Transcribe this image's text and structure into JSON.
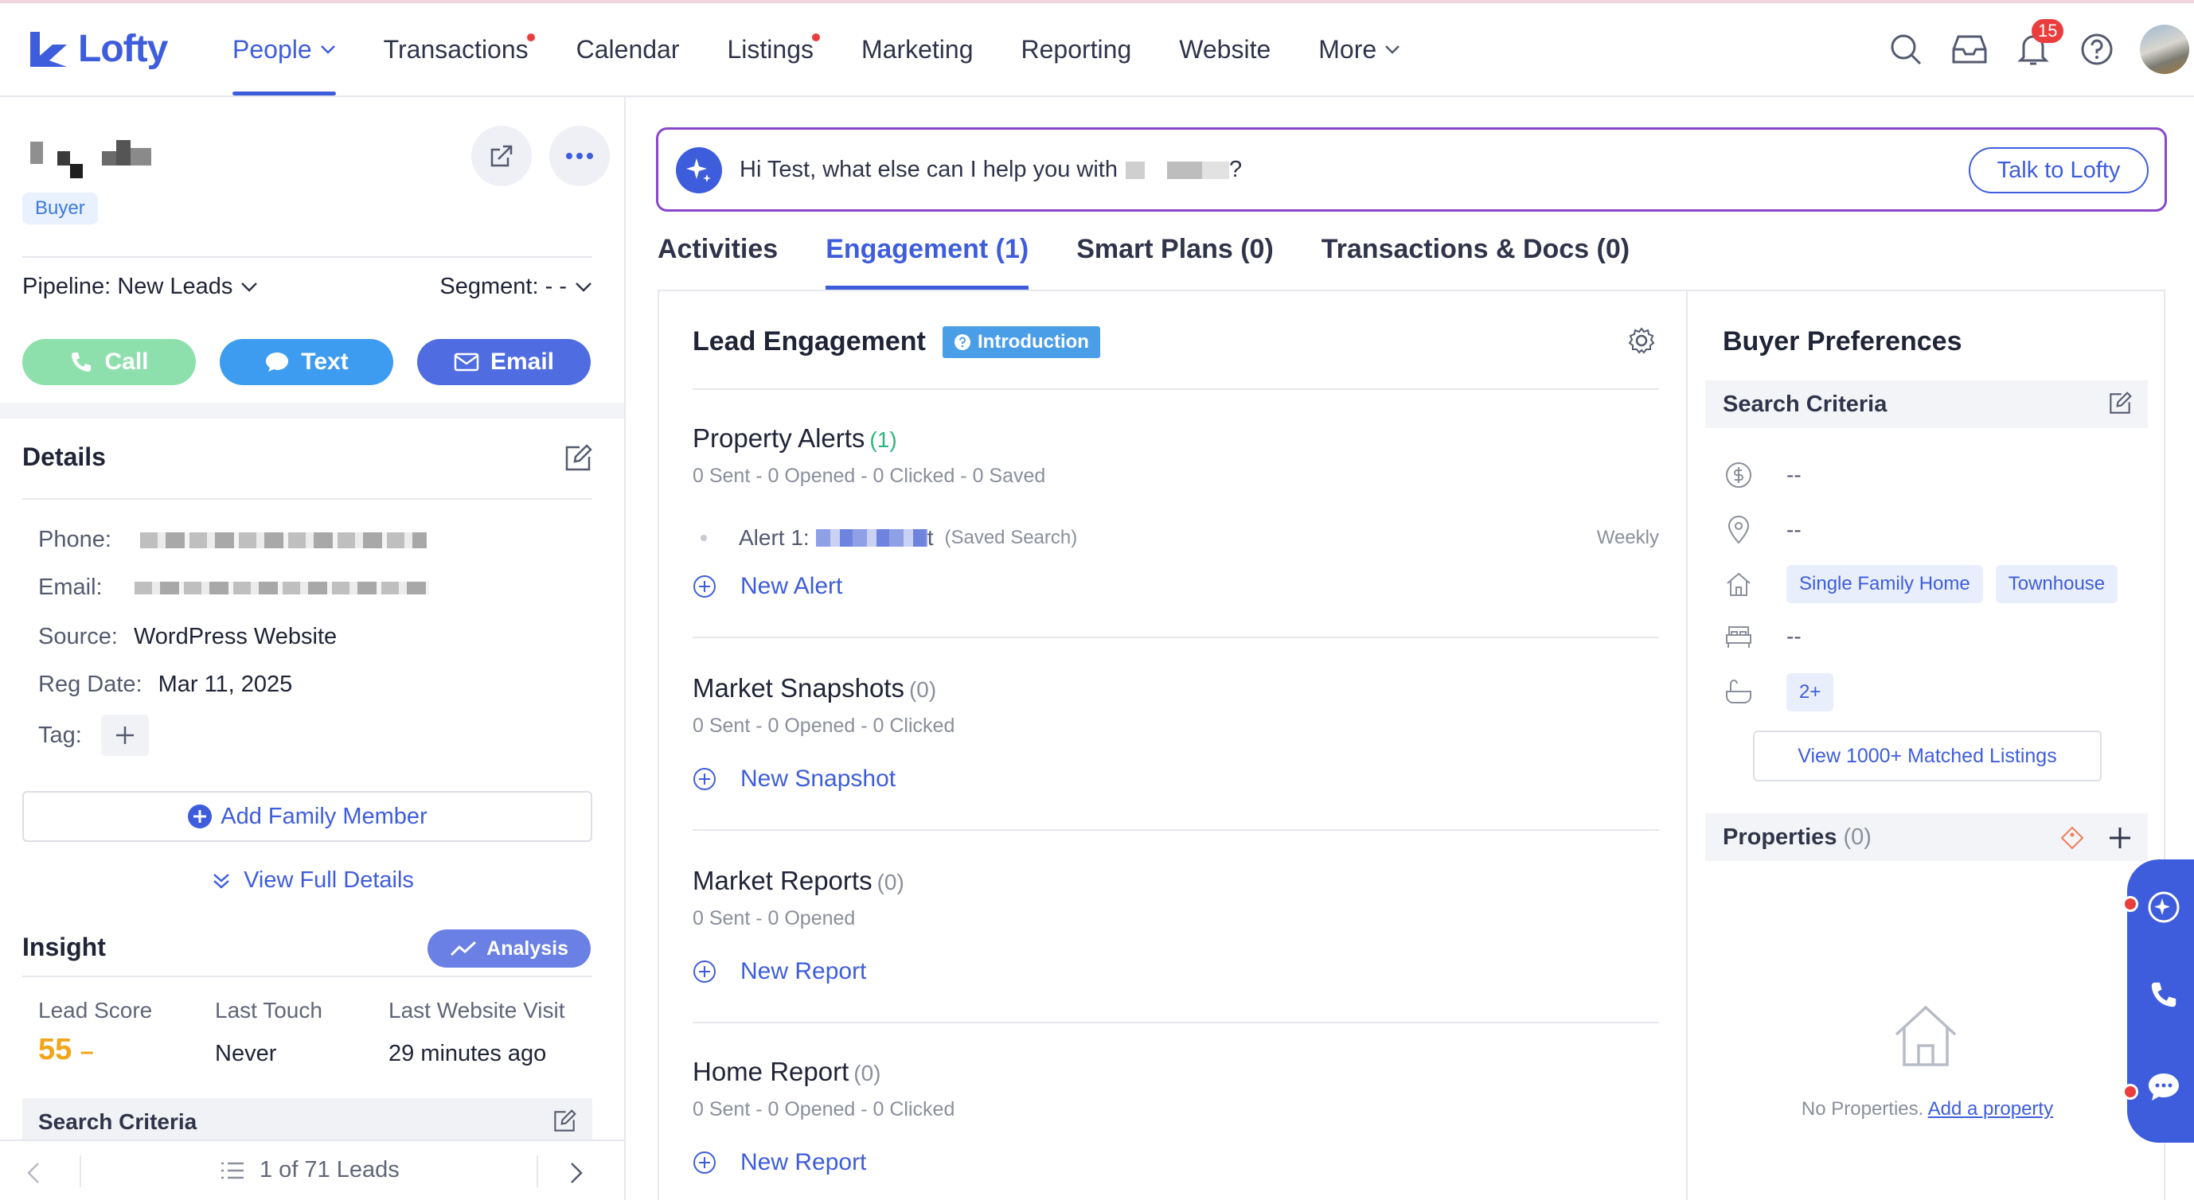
{
  "app": {
    "logo_text": "Lofty",
    "brand_color": "#3e5ddc"
  },
  "nav": {
    "items": [
      {
        "label": "People",
        "active": true,
        "dropdown": true,
        "dot": false
      },
      {
        "label": "Transactions",
        "active": false,
        "dropdown": false,
        "dot": true
      },
      {
        "label": "Calendar",
        "active": false,
        "dropdown": false,
        "dot": false
      },
      {
        "label": "Listings",
        "active": false,
        "dropdown": false,
        "dot": true
      },
      {
        "label": "Marketing",
        "active": false,
        "dropdown": false,
        "dot": false
      },
      {
        "label": "Reporting",
        "active": false,
        "dropdown": false,
        "dot": false
      },
      {
        "label": "Website",
        "active": false,
        "dropdown": false,
        "dot": false
      },
      {
        "label": "More",
        "active": false,
        "dropdown": true,
        "dot": false
      }
    ],
    "notification_count": "15",
    "icons": [
      "search-icon",
      "inbox-icon",
      "bell-icon",
      "help-icon",
      "avatar"
    ]
  },
  "lead": {
    "role_tag": "Buyer",
    "pipeline_label": "Pipeline:",
    "pipeline_value": "New Leads",
    "segment_label": "Segment:",
    "segment_value": "- -",
    "actions": {
      "call": "Call",
      "text": "Text",
      "email": "Email"
    }
  },
  "details": {
    "title": "Details",
    "phone_label": "Phone:",
    "email_label": "Email:",
    "source_label": "Source:",
    "source_value": "WordPress Website",
    "reg_label": "Reg Date:",
    "reg_value": "Mar 11, 2025",
    "tag_label": "Tag:",
    "add_family": "Add Family Member",
    "view_full": "View Full Details"
  },
  "insight": {
    "title": "Insight",
    "analysis_btn": "Analysis",
    "lead_score_label": "Lead Score",
    "lead_score_value": "55",
    "last_touch_label": "Last Touch",
    "last_touch_value": "Never",
    "last_visit_label": "Last Website Visit",
    "last_visit_value": "29 minutes ago",
    "search_criteria": "Search Criteria"
  },
  "pager": {
    "text": "1 of 71 Leads"
  },
  "assistant": {
    "prompt": "Hi Test, what else can I help you with",
    "prompt_end": "?",
    "button": "Talk to Lofty"
  },
  "tabs": [
    {
      "label": "Activities",
      "active": false
    },
    {
      "label": "Engagement (1)",
      "active": true
    },
    {
      "label": "Smart Plans (0)",
      "active": false
    },
    {
      "label": "Transactions & Docs (0)",
      "active": false
    }
  ],
  "engagement": {
    "title": "Lead Engagement",
    "intro_tag": "Introduction",
    "property_alerts": {
      "title": "Property Alerts",
      "count": "(1)",
      "stats": "0 Sent - 0 Opened - 0 Clicked - 0 Saved",
      "alert_label": "Alert 1:",
      "alert_suffix": "t",
      "alert_saved": "(Saved Search)",
      "alert_freq": "Weekly",
      "new_label": "New Alert"
    },
    "market_snapshots": {
      "title": "Market Snapshots",
      "count": "(0)",
      "stats": "0 Sent - 0 Opened - 0 Clicked",
      "new_label": "New Snapshot"
    },
    "market_reports": {
      "title": "Market Reports",
      "count": "(0)",
      "stats": "0 Sent - 0 Opened",
      "new_label": "New Report"
    },
    "home_report": {
      "title": "Home Report",
      "count": "(0)",
      "stats": "0 Sent - 0 Opened - 0 Clicked",
      "new_label": "New Report"
    }
  },
  "preferences": {
    "title": "Buyer Preferences",
    "search_criteria": "Search Criteria",
    "price": "--",
    "location": "--",
    "home_types": [
      "Single Family Home",
      "Townhouse"
    ],
    "beds": "--",
    "baths": "2+",
    "matched_btn": "View 1000+ Matched Listings",
    "properties_title": "Properties",
    "properties_count": "(0)",
    "no_props": "No Properties.",
    "add_property": "Add a property"
  }
}
